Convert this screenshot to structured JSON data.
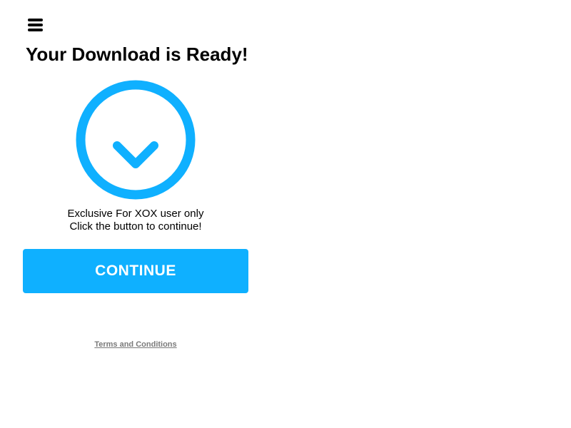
{
  "header": {
    "menu_icon": "hamburger-menu-icon"
  },
  "main": {
    "title": "Your Download is Ready!",
    "graphic_icon": "download-arrow-icon",
    "message_line1": "Exclusive For XOX user only",
    "message_line2": "Click the button to continue!",
    "continue_label": "CONTINUE"
  },
  "footer": {
    "terms_label": "Terms and Conditions"
  },
  "colors": {
    "accent": "#0fb0ff",
    "text": "#000000",
    "link": "#7a7a7a",
    "background": "#ffffff"
  }
}
